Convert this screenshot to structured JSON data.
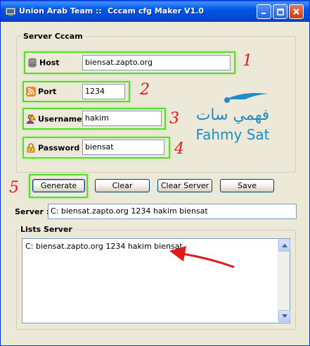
{
  "window": {
    "title_left": "Union Arab Team ::",
    "title_center": "Cccam cfg Maker V1.0",
    "buttons": {
      "minimize": "_",
      "maximize": "□",
      "close": "✕"
    }
  },
  "server_group": {
    "label": "Server Cccam",
    "host_label": "Host",
    "host_value": "biensat.zapto.org",
    "port_label": "Port",
    "port_value": "1234",
    "username_label": "Username",
    "username_value": "hakim",
    "password_label": "Password",
    "password_value": "biensat"
  },
  "annotations": [
    "1",
    "2",
    "3",
    "4",
    "5"
  ],
  "logo": {
    "arabic": "فهمي سات",
    "latin": "Fahmy Sat"
  },
  "actions": {
    "generate": "Generate",
    "clear": "Clear",
    "clear_server": "Clear Server",
    "save": "Save"
  },
  "server_line": {
    "label": "Server :",
    "value": "C: biensat.zapto.org 1234 hakim biensat"
  },
  "lists_group": {
    "label": "Lists Server",
    "items": [
      "C: biensat.zapto.org 1234 hakim biensat"
    ]
  },
  "colors": {
    "highlight_green": "#5adc2a",
    "annotation_red": "#e0191b",
    "logo_blue": "#1e8cc8"
  }
}
